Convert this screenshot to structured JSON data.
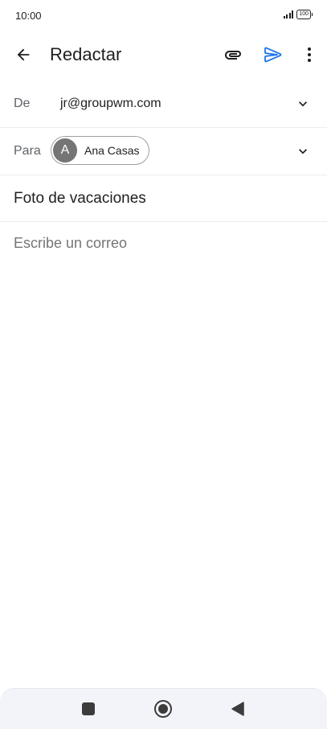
{
  "status_bar": {
    "time": "10:00",
    "battery": "100",
    "signal_icon": "signal-bars-icon",
    "battery_icon": "battery-icon"
  },
  "app_bar": {
    "title": "Redactar",
    "back_icon": "arrow-back-icon",
    "attach_icon": "paperclip-icon",
    "send_icon": "send-icon",
    "more_icon": "more-vertical-icon"
  },
  "compose": {
    "from_label": "De",
    "from_value": "jr@groupwm.com",
    "to_label": "Para",
    "recipient": {
      "initial": "A",
      "name": "Ana Casas"
    },
    "subject": "Foto de vacaciones",
    "body_placeholder": "Escribe un correo"
  },
  "nav_bar": {
    "recents_icon": "square-icon",
    "home_icon": "circle-home-icon",
    "back_icon": "triangle-back-icon"
  },
  "colors": {
    "accent": "#1a73e8",
    "text": "#1f1f1f",
    "secondary_text": "#5f6368",
    "avatar": "#757575",
    "nav_bg": "#f3f4f9"
  }
}
